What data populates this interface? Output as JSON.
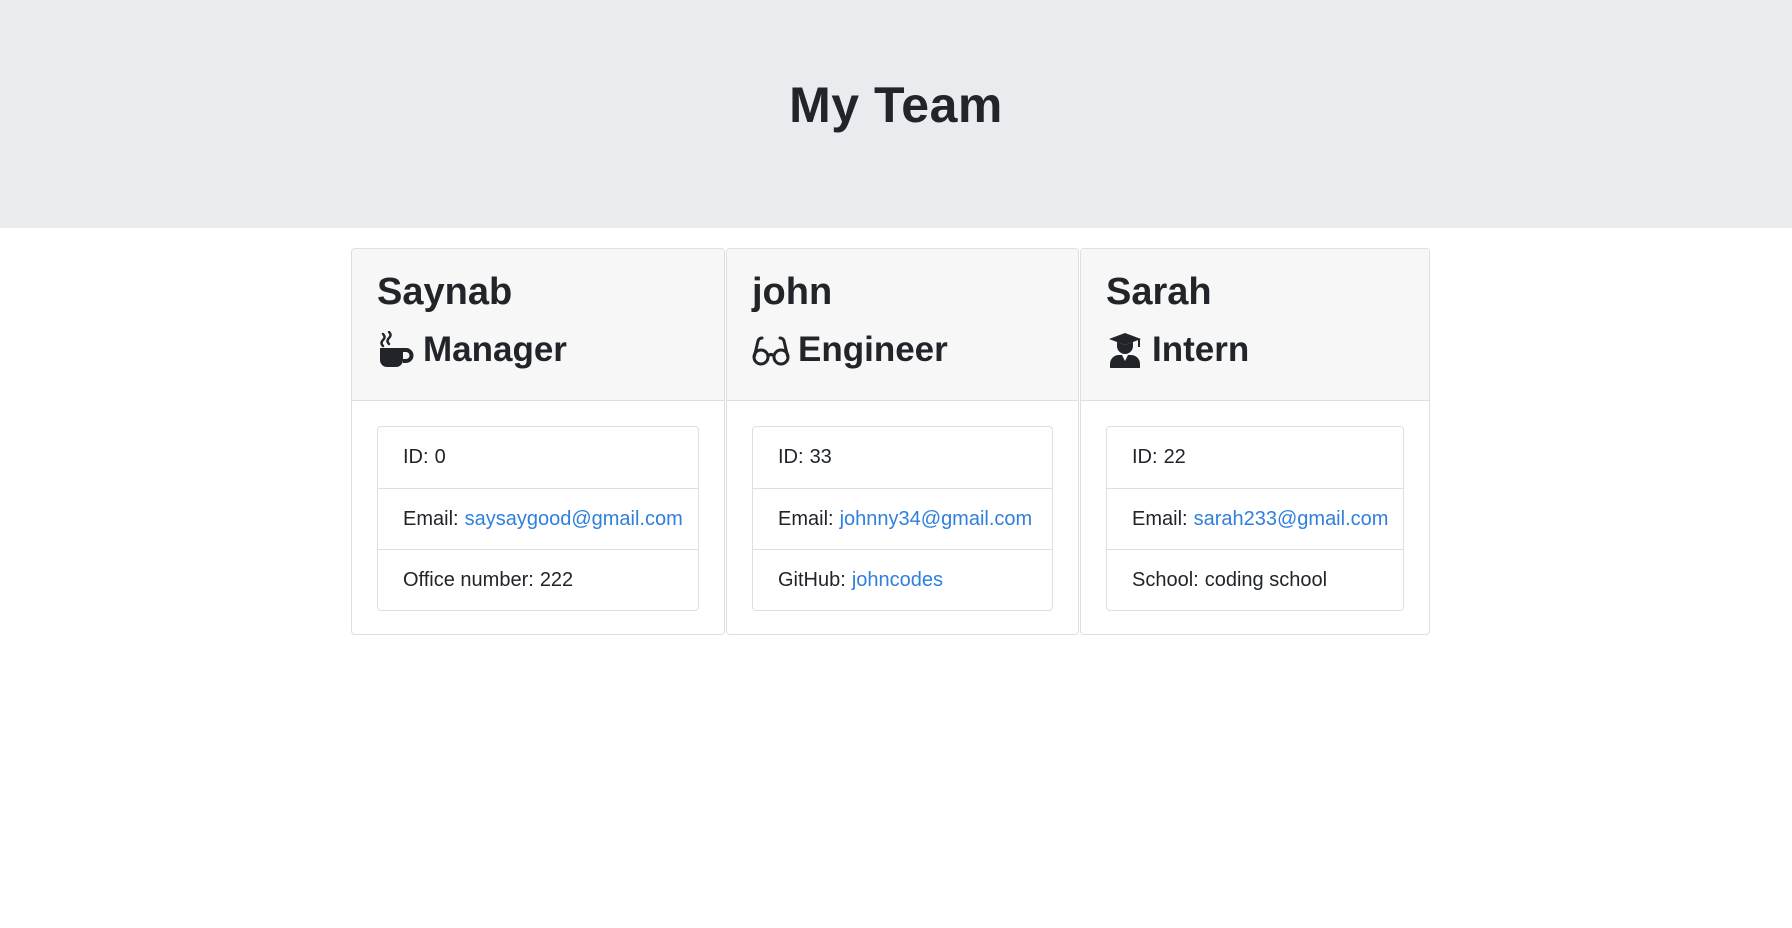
{
  "header": {
    "title": "My Team"
  },
  "team": [
    {
      "name": "Saynab",
      "role": "Manager",
      "icon": "coffee-mug-icon",
      "id_label": "ID:",
      "id": "0",
      "email_label": "Email:",
      "email": "saysaygood@gmail.com",
      "extra_label": "Office number:",
      "extra": "222"
    },
    {
      "name": "john",
      "role": "Engineer",
      "icon": "glasses-icon",
      "id_label": "ID:",
      "id": "33",
      "email_label": "Email:",
      "email": "johnny34@gmail.com",
      "extra_label": "GitHub:",
      "extra": "johncodes"
    },
    {
      "name": "Sarah",
      "role": "Intern",
      "icon": "graduate-icon",
      "id_label": "ID:",
      "id": "22",
      "email_label": "Email:",
      "email": "sarah233@gmail.com",
      "extra_label": "School:",
      "extra": "coding school"
    }
  ],
  "colors": {
    "header_bg": "#e9ecef",
    "card_header_bg": "#f7f7f7",
    "link": "#2f7fdc",
    "text": "#212529"
  }
}
